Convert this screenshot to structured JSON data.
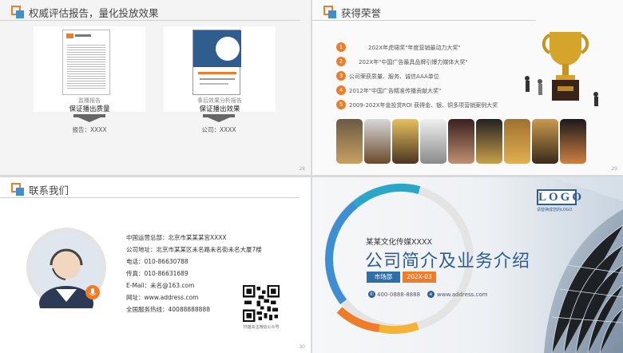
{
  "slide1": {
    "title": "权威评估报告，量化投放效果",
    "page_num": "28",
    "cards": [
      {
        "caption": "监播报告",
        "subtitle": "保证播出质量",
        "footer": "报告：XXXX"
      },
      {
        "caption": "事后效果分析报告",
        "subtitle": "保证播出效果",
        "footer": "公司：XXXX"
      }
    ]
  },
  "slide2": {
    "title": "获得荣誉",
    "page_num": "29",
    "honors": [
      {
        "num": "1",
        "text": "202X年虎啸奖\"年度营销最动力大奖\""
      },
      {
        "num": "2",
        "text": "202X年\"中国广告最具品牌引爆力媒体大奖\""
      },
      {
        "num": "3",
        "text": "公司荣获质量、服务、诚信AAA单位"
      },
      {
        "num": "4",
        "text": "2012年\"中国广告精准传播贡献大奖\""
      },
      {
        "num": "5",
        "text": "2009-202X年金投赏ROI 获得金、银、铜多项营销案例大奖"
      }
    ]
  },
  "slide3": {
    "title": "联系我们",
    "page_num": "30",
    "contacts": [
      "中国运营总部：北京市某某某宫XXXX",
      "公司地址：北京市某某区未名路未名街未名大厦7楼",
      "电话：010-86630788",
      "传真：010-86631689",
      "E-Mail：未名@163.com",
      "网址：www.address.com",
      "全国服务热线：40088888888"
    ],
    "qr_caption": "扫描关注微信公众号"
  },
  "slide4": {
    "logo_text": "LOGO",
    "logo_sub": "请替换成您的LOGO",
    "company": "某某文化传媒XXXX",
    "main_title": "公司简介及业务介绍",
    "department": "市场部",
    "date": "202X-03",
    "phone": "400-0888-8888",
    "website": "www.address.com"
  },
  "colors": {
    "orange": "#f07c2a",
    "blue": "#3d8fd1",
    "navy": "#2f5e8e"
  }
}
